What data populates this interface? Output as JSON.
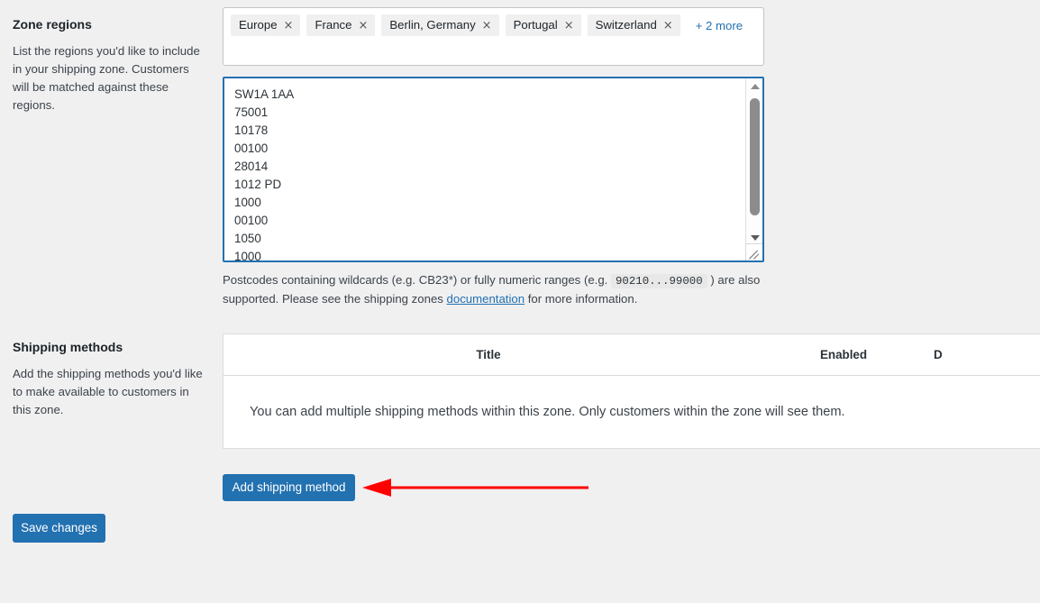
{
  "zone_regions": {
    "title": "Zone regions",
    "description": "List the regions you'd like to include in your shipping zone. Customers will be matched against these regions.",
    "chips": [
      {
        "label": "Europe",
        "remove_icon": "close-icon"
      },
      {
        "label": "France",
        "remove_icon": "close-icon"
      },
      {
        "label": "Berlin, Germany",
        "remove_icon": "close-icon"
      },
      {
        "label": "Portugal",
        "remove_icon": "close-icon"
      },
      {
        "label": "Switzerland",
        "remove_icon": "close-icon"
      }
    ],
    "more_label": "+ 2 more",
    "close_glyph": "×"
  },
  "postcodes": {
    "value": "SW1A 1AA\n75001\n10178\n00100\n28014\n1012 PD\n1000\n00100\n1050\n1000",
    "lines": [
      "SW1A 1AA",
      "75001",
      "10178",
      "00100",
      "28014",
      "1012 PD",
      "1000",
      "00100",
      "1050",
      "1000"
    ],
    "help_prefix": "Postcodes containing wildcards (e.g. CB23*) or fully numeric ranges (e.g. ",
    "help_code": "90210...99000",
    "help_middle": " ) are also supported. Please see the shipping zones ",
    "help_link": "documentation",
    "help_suffix": " for more information.",
    "scrollbar": {
      "up_icon": "caret-up-icon",
      "down_icon": "caret-down-icon",
      "resize_icon": "resize-grip-icon"
    }
  },
  "shipping_methods": {
    "title": "Shipping methods",
    "description": "Add the shipping methods you'd like to make available to customers in this zone.",
    "columns": [
      "Title",
      "Enabled",
      "D"
    ],
    "empty_message": "You can add multiple shipping methods within this zone. Only customers within the zone will see them.",
    "add_button": "Add shipping method"
  },
  "footer": {
    "save_button": "Save changes"
  },
  "annotation": {
    "arrow_color": "#ff0000",
    "direction": "left"
  },
  "colors": {
    "accent": "#2271b1",
    "background": "#f0f0f1",
    "surface": "#ffffff",
    "border": "#c3c4c7",
    "text": "#1d2327",
    "link": "#2271b1"
  }
}
